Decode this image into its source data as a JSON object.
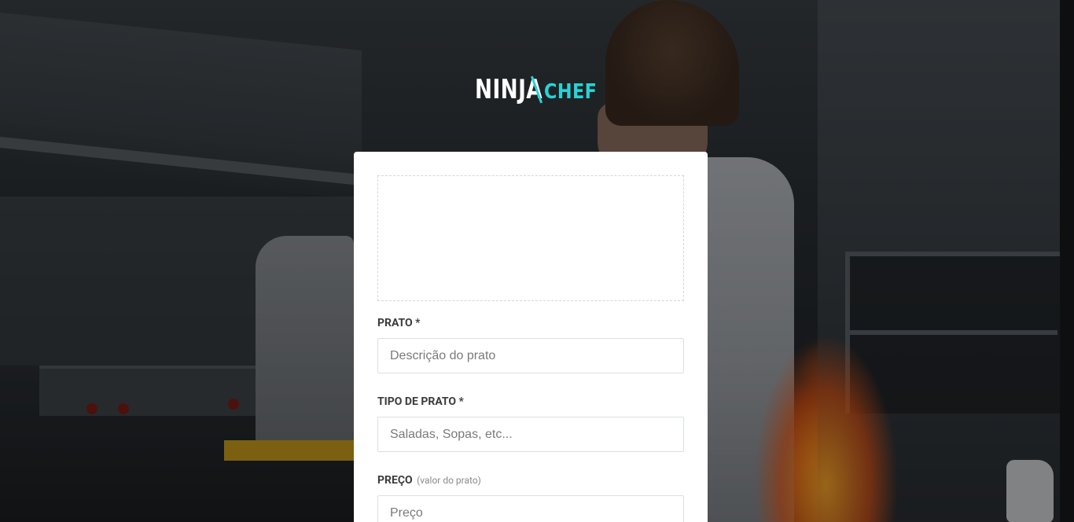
{
  "logo": {
    "part1": "NINJA",
    "part2": "CHEF",
    "accent_color": "#28d3d6"
  },
  "form": {
    "image_upload": {
      "icon": "upload-area"
    },
    "prato": {
      "label": "PRATO *",
      "placeholder": "Descrição do prato"
    },
    "tipo": {
      "label": "TIPO DE PRATO *",
      "placeholder": "Saladas, Sopas, etc..."
    },
    "preco": {
      "label": "PREÇO",
      "hint": "(valor do prato)",
      "placeholder": "Preço"
    }
  }
}
